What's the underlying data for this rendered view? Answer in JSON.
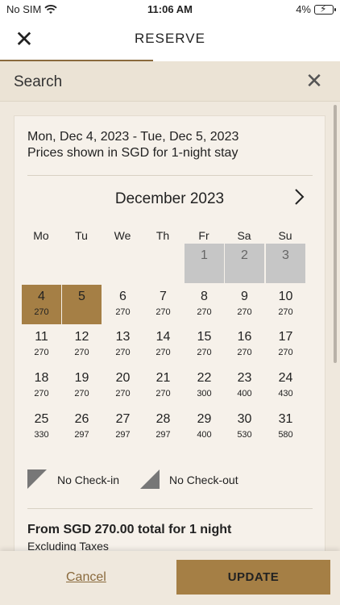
{
  "status_bar": {
    "carrier": "No SIM",
    "time": "11:06 AM",
    "battery": "4%"
  },
  "nav": {
    "title": "RESERVE"
  },
  "search": {
    "label": "Search"
  },
  "summary": {
    "date_range": "Mon, Dec 4, 2023 - Tue, Dec 5, 2023",
    "price_note": "Prices shown in SGD for 1-night stay"
  },
  "calendar": {
    "month": "December 2023",
    "weekdays": [
      "Mo",
      "Tu",
      "We",
      "Th",
      "Fr",
      "Sa",
      "Su"
    ],
    "weeks": [
      [
        null,
        null,
        null,
        null,
        {
          "day": "1",
          "price": "",
          "state": "disabled"
        },
        {
          "day": "2",
          "price": "",
          "state": "disabled"
        },
        {
          "day": "3",
          "price": "",
          "state": "disabled"
        }
      ],
      [
        {
          "day": "4",
          "price": "270",
          "state": "selected"
        },
        {
          "day": "5",
          "price": "",
          "state": "selected"
        },
        {
          "day": "6",
          "price": "270",
          "state": "normal"
        },
        {
          "day": "7",
          "price": "270",
          "state": "normal"
        },
        {
          "day": "8",
          "price": "270",
          "state": "normal"
        },
        {
          "day": "9",
          "price": "270",
          "state": "normal"
        },
        {
          "day": "10",
          "price": "270",
          "state": "normal"
        }
      ],
      [
        {
          "day": "11",
          "price": "270",
          "state": "normal"
        },
        {
          "day": "12",
          "price": "270",
          "state": "normal"
        },
        {
          "day": "13",
          "price": "270",
          "state": "normal"
        },
        {
          "day": "14",
          "price": "270",
          "state": "normal"
        },
        {
          "day": "15",
          "price": "270",
          "state": "normal"
        },
        {
          "day": "16",
          "price": "270",
          "state": "normal"
        },
        {
          "day": "17",
          "price": "270",
          "state": "normal"
        }
      ],
      [
        {
          "day": "18",
          "price": "270",
          "state": "normal"
        },
        {
          "day": "19",
          "price": "270",
          "state": "normal"
        },
        {
          "day": "20",
          "price": "270",
          "state": "normal"
        },
        {
          "day": "21",
          "price": "270",
          "state": "normal"
        },
        {
          "day": "22",
          "price": "300",
          "state": "normal"
        },
        {
          "day": "23",
          "price": "400",
          "state": "normal"
        },
        {
          "day": "24",
          "price": "430",
          "state": "normal"
        }
      ],
      [
        {
          "day": "25",
          "price": "330",
          "state": "normal"
        },
        {
          "day": "26",
          "price": "297",
          "state": "normal"
        },
        {
          "day": "27",
          "price": "297",
          "state": "normal"
        },
        {
          "day": "28",
          "price": "297",
          "state": "normal"
        },
        {
          "day": "29",
          "price": "400",
          "state": "normal"
        },
        {
          "day": "30",
          "price": "530",
          "state": "normal"
        },
        {
          "day": "31",
          "price": "580",
          "state": "normal"
        }
      ]
    ]
  },
  "legend": {
    "no_checkin": "No Check-in",
    "no_checkout": "No Check-out"
  },
  "total": {
    "line": "From SGD 270.00 total for 1 night",
    "note": "Excluding Taxes"
  },
  "footer": {
    "cancel": "Cancel",
    "update": "UPDATE"
  },
  "colors": {
    "accent": "#a57f45",
    "disabled": "#c6c6c6",
    "background": "#efe8dd"
  }
}
